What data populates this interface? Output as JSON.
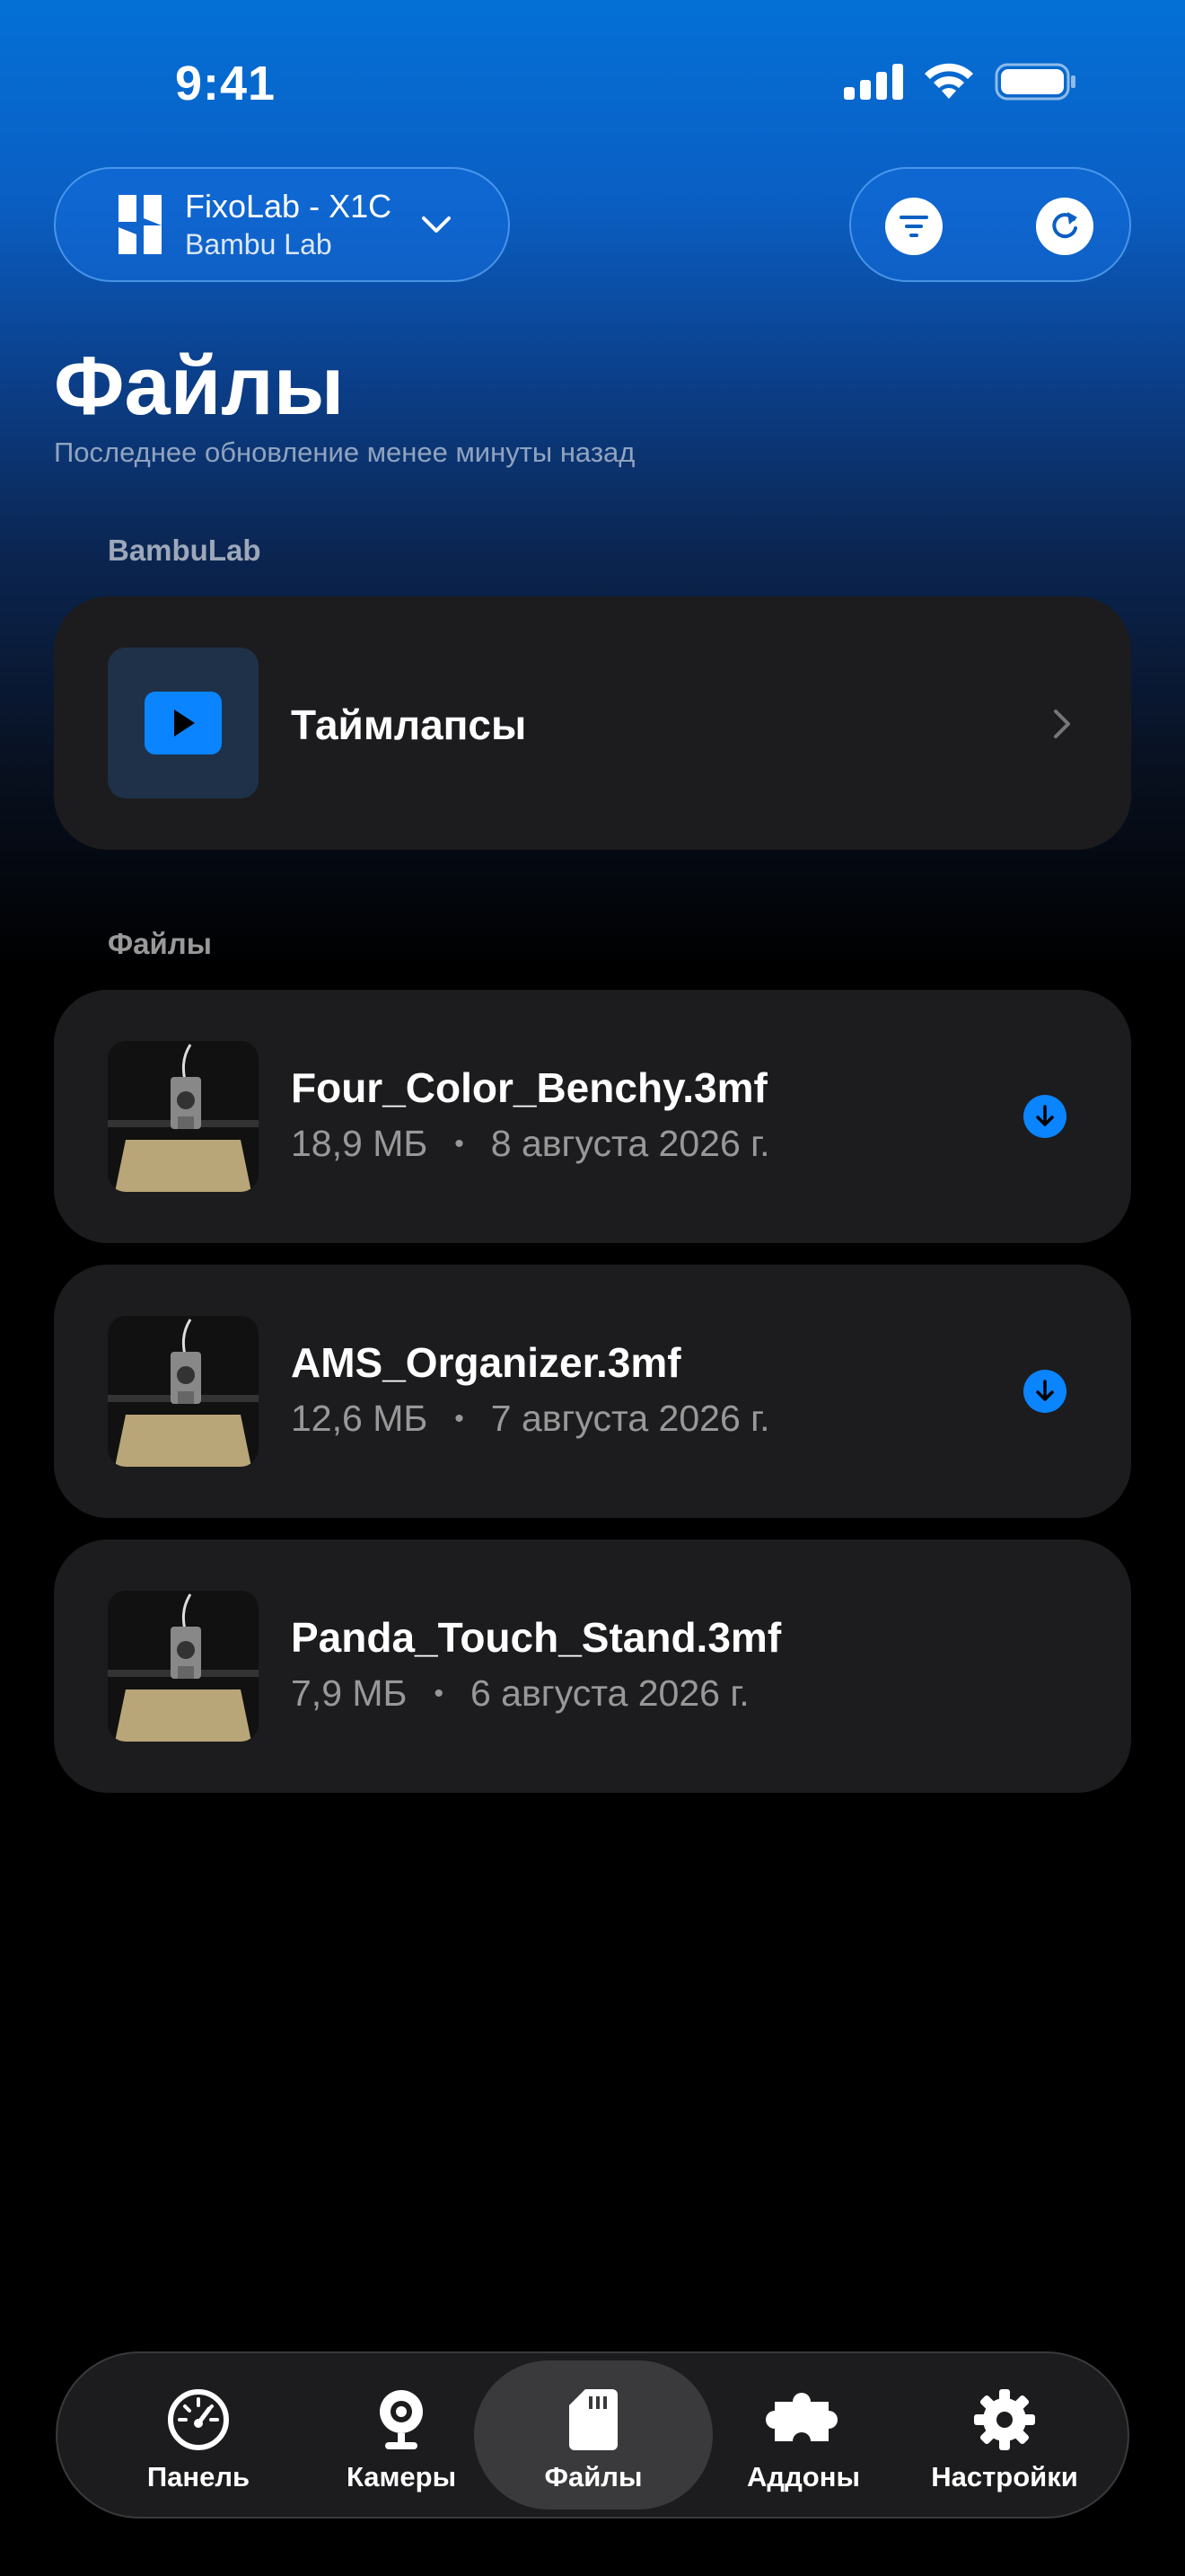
{
  "status_bar": {
    "time": "9:41"
  },
  "printer_selector": {
    "name": "FixoLab - X1C",
    "brand": "Bambu Lab"
  },
  "header": {
    "title": "Файлы",
    "subtitle": "Последнее обновление менее минуты назад"
  },
  "sections": {
    "bambulab": {
      "label": "BambuLab",
      "timelapse": {
        "label": "Таймлапсы",
        "icon": "play-icon"
      }
    },
    "files": {
      "label": "Файлы",
      "items": [
        {
          "name": "Four_Color_Benchy.3mf",
          "size": "18,9 МБ",
          "date": "8 августа 2026 г.",
          "downloadable": true
        },
        {
          "name": "AMS_Organizer.3mf",
          "size": "12,6 МБ",
          "date": "7 августа 2026 г.",
          "downloadable": true
        },
        {
          "name": "Panda_Touch_Stand.3mf",
          "size": "7,9 МБ",
          "date": "6 августа 2026 г.",
          "downloadable": false
        }
      ],
      "separator": "•"
    }
  },
  "tabbar": {
    "tabs": [
      {
        "label": "Панель",
        "icon": "gauge-icon"
      },
      {
        "label": "Камеры",
        "icon": "webcam-icon"
      },
      {
        "label": "Файлы",
        "icon": "sd-card-icon",
        "active": true
      },
      {
        "label": "Аддоны",
        "icon": "puzzle-icon"
      },
      {
        "label": "Настройки",
        "icon": "gear-icon"
      }
    ]
  },
  "colors": {
    "accent": "#0a84ff",
    "card": "#1c1c1e",
    "header_blue": "#0470d6"
  }
}
